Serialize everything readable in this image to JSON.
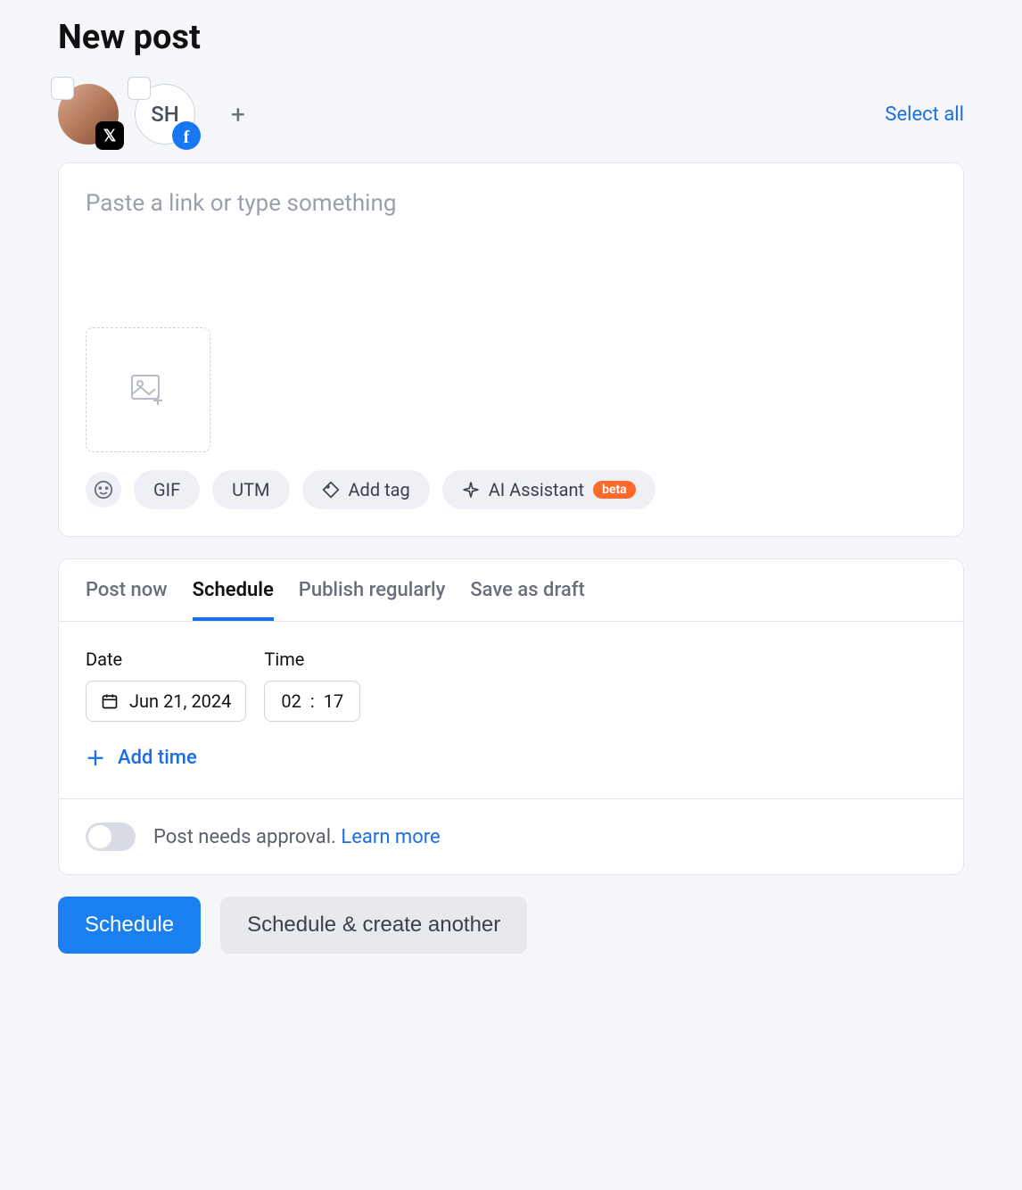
{
  "title": "New post",
  "accounts": {
    "items": [
      {
        "type": "avatar",
        "platform": "X"
      },
      {
        "type": "initials",
        "initials": "SH",
        "platform": "Facebook"
      }
    ],
    "select_all_label": "Select all"
  },
  "composer": {
    "placeholder": "Paste a link or type something",
    "value": "",
    "chips": {
      "gif": "GIF",
      "utm": "UTM",
      "add_tag": "Add tag",
      "ai_assistant": "AI Assistant",
      "ai_badge": "beta"
    }
  },
  "tabs": {
    "post_now": "Post now",
    "schedule": "Schedule",
    "publish_regularly": "Publish regularly",
    "save_draft": "Save as draft",
    "active": "schedule"
  },
  "schedule": {
    "date_label": "Date",
    "date_value": "Jun 21, 2024",
    "time_label": "Time",
    "time_hour": "02",
    "time_sep": ":",
    "time_min": "17",
    "add_time_label": "Add time"
  },
  "approval": {
    "text": "Post needs approval.",
    "learn_more": "Learn more",
    "enabled": false
  },
  "actions": {
    "primary": "Schedule",
    "secondary": "Schedule & create another"
  }
}
